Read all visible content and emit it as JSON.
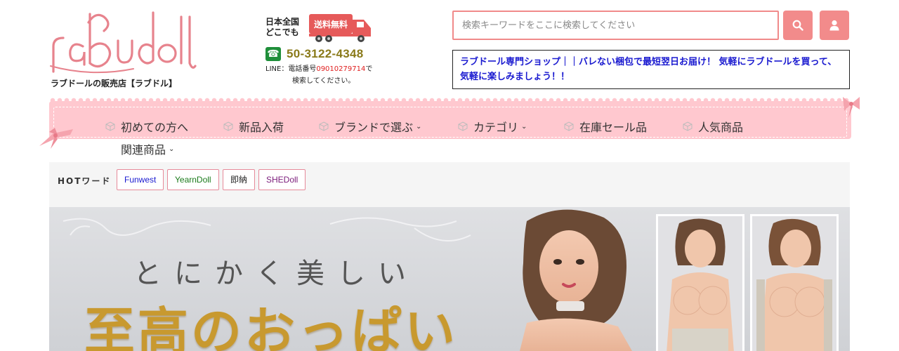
{
  "header": {
    "logo_text": "rabudoll",
    "logo_caption": "ラブドールの販売店【ラブドル】",
    "delivery": {
      "nationwide": "日本全国どこでも",
      "free_shipping": "送料無料",
      "phone": "50-3122-4348",
      "line_prefix": "LINE：電話番号",
      "line_number": "09010279714",
      "line_suffix": "で",
      "line_text2": "検索してください。"
    },
    "search": {
      "placeholder": "検索キーワードをここに検索してください"
    },
    "tagline": "ラブドール専門ショップ｜｜バレない梱包で最短翌日お届け！ 気軽にラブドールを買って、気軽に楽しみましょう！！"
  },
  "nav": {
    "items": [
      {
        "label": "初めての方へ",
        "has_dropdown": false
      },
      {
        "label": "新品入荷",
        "has_dropdown": false
      },
      {
        "label": "ブランドで選ぶ",
        "has_dropdown": true
      },
      {
        "label": "カテゴリ",
        "has_dropdown": true
      },
      {
        "label": "在庫セール品",
        "has_dropdown": false
      },
      {
        "label": "人気商品",
        "has_dropdown": false
      },
      {
        "label": "関連商品",
        "has_dropdown": true
      }
    ],
    "chevron": "⌄"
  },
  "hot": {
    "label": "HOTワード",
    "tags": [
      {
        "label": "Funwest",
        "color": "#1a1ad0"
      },
      {
        "label": "YearnDoll",
        "color": "#1a7a1a"
      },
      {
        "label": "即納",
        "color": "#222222"
      },
      {
        "label": "SHEDoll",
        "color": "#7a1a7a"
      }
    ]
  },
  "banner": {
    "subtitle": "とにかく美しい",
    "title": "至高のおっぱい"
  },
  "colors": {
    "accent": "#f28b8b",
    "nav_bg": "#ffc8cf",
    "tagline": "#1a1ad0",
    "title_gold": "#c8992f"
  },
  "icons": {
    "search": "search-icon",
    "user": "user-icon",
    "nav": "cube-icon",
    "phone": "phone-icon"
  }
}
